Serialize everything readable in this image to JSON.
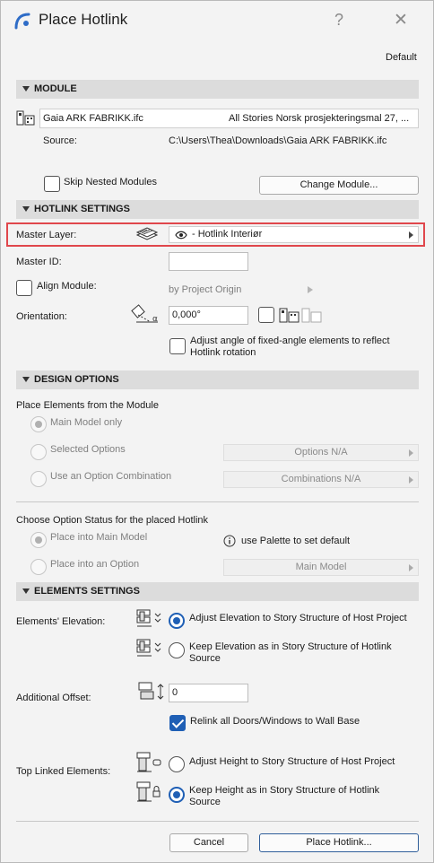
{
  "window": {
    "title": "Place Hotlink",
    "help_symbol": "?",
    "close_symbol": "✕"
  },
  "header": {
    "profile": "Default"
  },
  "module": {
    "section_label": "MODULE",
    "file_name": "Gaia ARK FABRIKK.ifc",
    "stories": "All Stories Norsk prosjekteringsmal 27, ...",
    "source_label": "Source:",
    "source_path": "C:\\Users\\Thea\\Downloads\\Gaia ARK FABRIKK.ifc",
    "skip_nested_label": "Skip Nested Modules",
    "skip_nested_checked": false,
    "change_button": "Change Module..."
  },
  "hotlink_settings": {
    "section_label": "HOTLINK SETTINGS",
    "master_layer_label": "Master Layer:",
    "master_layer_value": "- Hotlink Interiør",
    "master_id_label": "Master ID:",
    "master_id_value": "",
    "align_module_label": "Align Module:",
    "align_module_checked": false,
    "align_module_value": "by Project Origin",
    "orientation_label": "Orientation:",
    "orientation_value": "0,000°",
    "adjust_angle_label_1": "Adjust angle of fixed-angle elements to reflect",
    "adjust_angle_label_2": "Hotlink rotation",
    "adjust_angle_checked": false
  },
  "design_options": {
    "section_label": "DESIGN OPTIONS",
    "place_from_label": "Place Elements from the Module",
    "main_model_only": "Main Model only",
    "selected_options": "Selected Options",
    "options_dropdown": "Options N/A",
    "use_combination": "Use an Option Combination",
    "combinations_dropdown": "Combinations N/A",
    "choose_status_label": "Choose Option Status for the placed Hotlink",
    "place_into_main": "Place into Main Model",
    "palette_hint": "use Palette to set default",
    "place_into_option": "Place into an Option",
    "main_model_dropdown": "Main Model"
  },
  "elements_settings": {
    "section_label": "ELEMENTS SETTINGS",
    "elevation_label": "Elements' Elevation:",
    "adjust_elevation": "Adjust Elevation to Story Structure of Host Project",
    "keep_elevation_1": "Keep Elevation as in Story Structure of Hotlink",
    "keep_elevation_2": "Source",
    "additional_offset_label": "Additional Offset:",
    "additional_offset_value": "0",
    "relink_label": "Relink all Doors/Windows to Wall Base",
    "relink_checked": true,
    "top_linked_label": "Top Linked Elements:",
    "adjust_height": "Adjust Height to Story Structure of Host Project",
    "keep_height_1": "Keep Height as in Story Structure of Hotlink",
    "keep_height_2": "Source"
  },
  "footer": {
    "cancel": "Cancel",
    "place": "Place Hotlink..."
  },
  "colors": {
    "accent": "#1f5fb5",
    "highlight_border": "#e0474c",
    "section_bg": "#dcdcdc"
  }
}
